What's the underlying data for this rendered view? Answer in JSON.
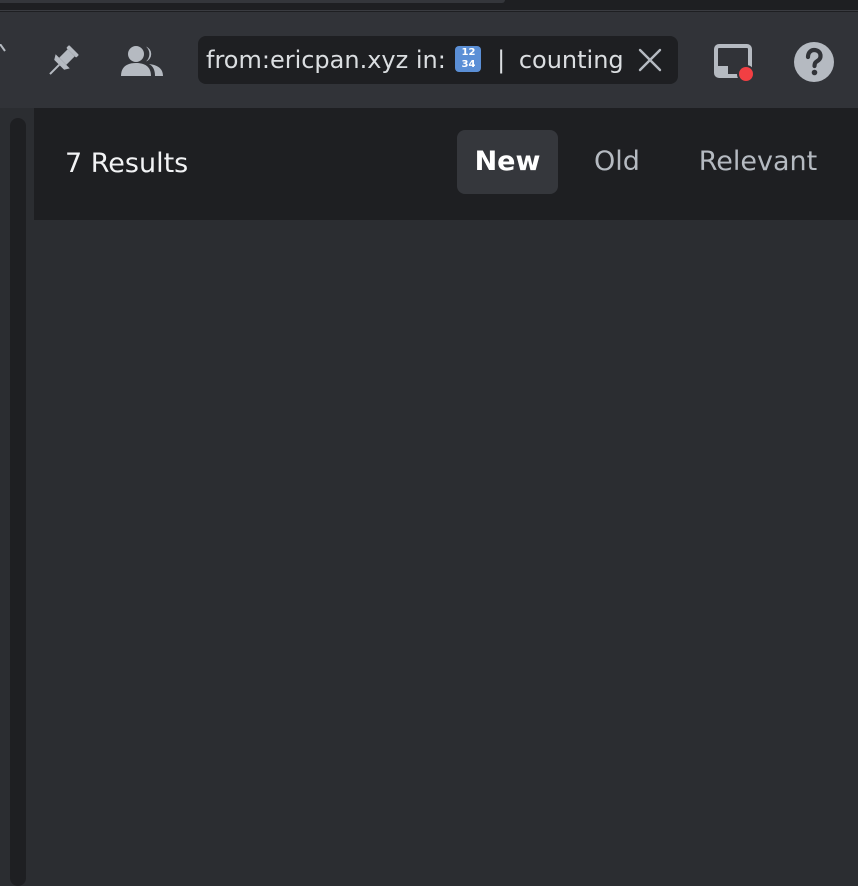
{
  "toolbar": {
    "search_query_prefix": "from:ericpan.xyz in:",
    "search_query_emoji_top": "12",
    "search_query_emoji_bottom": "34",
    "search_query_separator": "|",
    "search_query_channel": "counting",
    "icons": {
      "pin": "pin-icon",
      "members": "members-icon",
      "clear": "close-icon",
      "inbox": "inbox-icon",
      "help": "help-icon"
    }
  },
  "results": {
    "count_label": "7 Results",
    "sort_tabs": [
      {
        "label": "New",
        "active": true
      },
      {
        "label": "Old",
        "active": false
      },
      {
        "label": "Relevant",
        "active": false
      }
    ]
  },
  "colors": {
    "notification_dot": "#f23f43",
    "icon": "#b5bac1"
  }
}
